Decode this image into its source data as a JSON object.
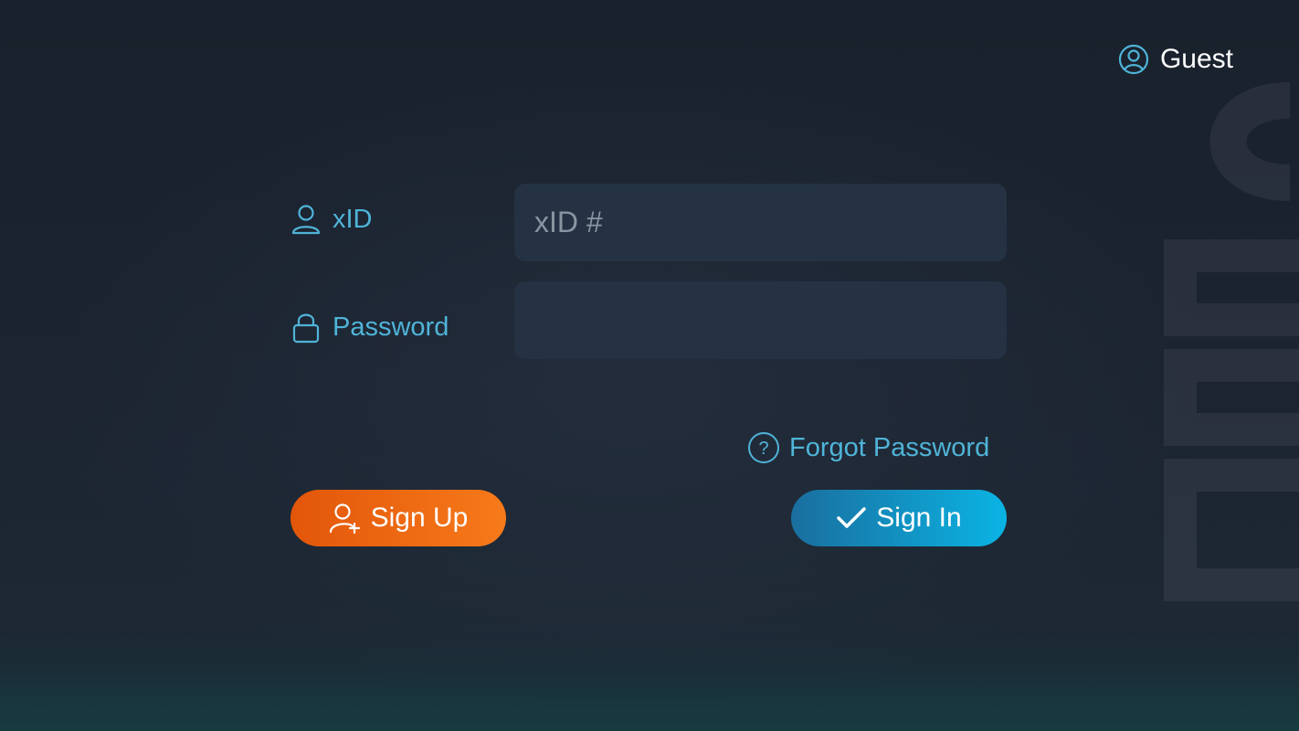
{
  "header": {
    "user_label": "Guest",
    "user_icon": "user-circle-icon"
  },
  "form": {
    "xid": {
      "label": "xID",
      "icon": "user-icon",
      "value": "",
      "placeholder": "xID #"
    },
    "password": {
      "label": "Password",
      "icon": "lock-icon",
      "value": "",
      "placeholder": ""
    },
    "forgot_password": {
      "label": "Forgot Password",
      "icon": "help-circle-icon"
    }
  },
  "actions": {
    "sign_up": {
      "label": "Sign Up",
      "icon": "add-user-icon",
      "color": "#f0680f"
    },
    "sign_in": {
      "label": "Sign In",
      "icon": "checkmark-icon",
      "color": "#0a9fd3"
    }
  },
  "theme": {
    "accent": "#4fb4d8",
    "background": "#1b2330",
    "input_background": "#243244"
  }
}
